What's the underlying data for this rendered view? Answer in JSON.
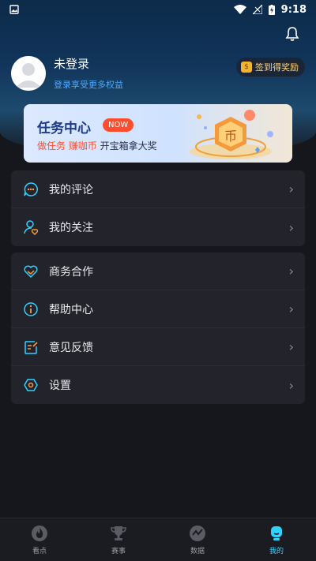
{
  "status_bar": {
    "time": "9:18"
  },
  "profile": {
    "name": "未登录",
    "subtitle": "登录享受更多权益",
    "signin_label": "签到得奖励"
  },
  "task_banner": {
    "title": "任务中心",
    "badge": "NOW",
    "sub_red": "做任务  赚咖币",
    "sub_dark": "开宝箱拿大奖"
  },
  "menu_group_1": [
    {
      "label": "我的评论",
      "icon": "comment-icon"
    },
    {
      "label": "我的关注",
      "icon": "follow-user-icon"
    }
  ],
  "menu_group_2": [
    {
      "label": "商务合作",
      "icon": "handshake-icon"
    },
    {
      "label": "帮助中心",
      "icon": "info-icon"
    },
    {
      "label": "意见反馈",
      "icon": "feedback-icon"
    },
    {
      "label": "设置",
      "icon": "settings-icon"
    }
  ],
  "tabs": [
    {
      "label": "看点",
      "icon": "flame-icon"
    },
    {
      "label": "赛事",
      "icon": "trophy-icon"
    },
    {
      "label": "数据",
      "icon": "chart-icon"
    },
    {
      "label": "我的",
      "icon": "profile-icon",
      "active": true
    }
  ],
  "colors": {
    "accent": "#2fd2ff",
    "link": "#4fa8ff",
    "badge": "#ff4d2d"
  }
}
